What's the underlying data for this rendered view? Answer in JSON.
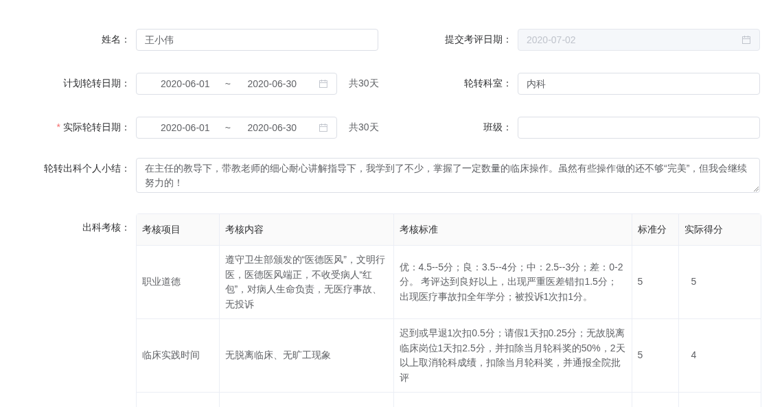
{
  "name_field": {
    "label": "姓名：",
    "value": "王小伟"
  },
  "submit_date": {
    "label": "提交考评日期：",
    "value": "2020-07-02",
    "disabled": true
  },
  "plan_date": {
    "label": "计划轮转日期：",
    "required": false,
    "start": "2020-06-01",
    "separator": "~",
    "end": "2020-06-30",
    "total": "共30天"
  },
  "department": {
    "label": "轮转科室：",
    "value": "内科"
  },
  "actual_date": {
    "label": "实际轮转日期：",
    "required": true,
    "required_mark": "*",
    "start": "2020-06-01",
    "separator": "~",
    "end": "2020-06-30",
    "total": "共30天"
  },
  "class_field": {
    "label": "班级："
  },
  "summary": {
    "label": "轮转出科个人小结：",
    "value": "在主任的教导下，带教老师的细心耐心讲解指导下，我学到了不少，掌握了一定数量的临床操作。虽然有些操作做的还不够“完美”，但我会继续努力的！"
  },
  "assessment": {
    "label": "出科考核：",
    "columns": [
      "考核项目",
      "考核内容",
      "考核标准",
      "标准分",
      "实际得分"
    ],
    "rows": [
      [
        "职业道德",
        "遵守卫生部颁发的“医德医风”，文明行医，医德医风端正，不收受病人“红包”，对病人生命负责，无医疗事故、无投诉",
        "优：4.5--5分；良：3.5--4分；中：2.5--3分；差：0-2分。 考评达到良好以上，出现严重医差错扣1.5分；出现医疗事故扣全年学分；被投诉1次扣1分。",
        "5",
        "5"
      ],
      [
        "临床实践时间",
        "无脱离临床、无旷工现象",
        "迟到或早退1次扣0.5分；请假1天扣0.25分；无故脱离临床岗位1天扣2.5分，并扣除当月轮科奖的50%，2天以上取消轮科成绩，扣除当月轮科奖，并通报全院批评",
        "5",
        "4"
      ]
    ]
  }
}
